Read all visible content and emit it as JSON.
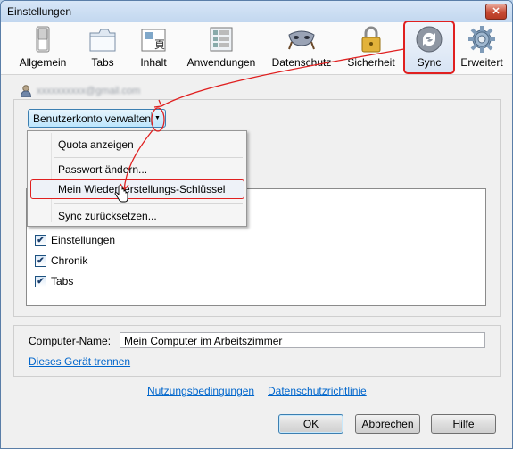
{
  "window": {
    "title": "Einstellungen",
    "close_label": "✕"
  },
  "toolbar": {
    "tabs": [
      {
        "label": "Allgemein",
        "icon": "switch-icon"
      },
      {
        "label": "Tabs",
        "icon": "tabs-icon"
      },
      {
        "label": "Inhalt",
        "icon": "content-icon"
      },
      {
        "label": "Anwendungen",
        "icon": "applications-icon"
      },
      {
        "label": "Datenschutz",
        "icon": "mask-icon"
      },
      {
        "label": "Sicherheit",
        "icon": "lock-icon"
      },
      {
        "label": "Sync",
        "icon": "sync-icon",
        "selected": true
      },
      {
        "label": "Erweitert",
        "icon": "gear-icon"
      }
    ]
  },
  "account": {
    "email": "xxxxxxxxxx@gmail.com",
    "manage_button": "Benutzerkonto verwalten",
    "dropdown_arrow": "▼"
  },
  "menu": {
    "items": [
      {
        "label": "Quota anzeigen"
      },
      {
        "label": "Passwort ändern..."
      },
      {
        "label": "Mein Wiederherstellungs-Schlüssel"
      },
      {
        "label": "Sync zurücksetzen..."
      }
    ]
  },
  "sync_options": [
    {
      "label": "Einstellungen",
      "checked": true
    },
    {
      "label": "Chronik",
      "checked": true
    },
    {
      "label": "Tabs",
      "checked": true
    }
  ],
  "checkmark": "✔",
  "computer": {
    "label": "Computer-Name:",
    "value": "Mein Computer im Arbeitszimmer",
    "disconnect_link": "Dieses Gerät trennen"
  },
  "links": {
    "terms": "Nutzungsbedingungen",
    "privacy": "Datenschutzrichtlinie"
  },
  "buttons": {
    "ok": "OK",
    "cancel": "Abbrechen",
    "help": "Hilfe"
  },
  "colors": {
    "annotation": "#e02020",
    "link": "#0066cc"
  }
}
